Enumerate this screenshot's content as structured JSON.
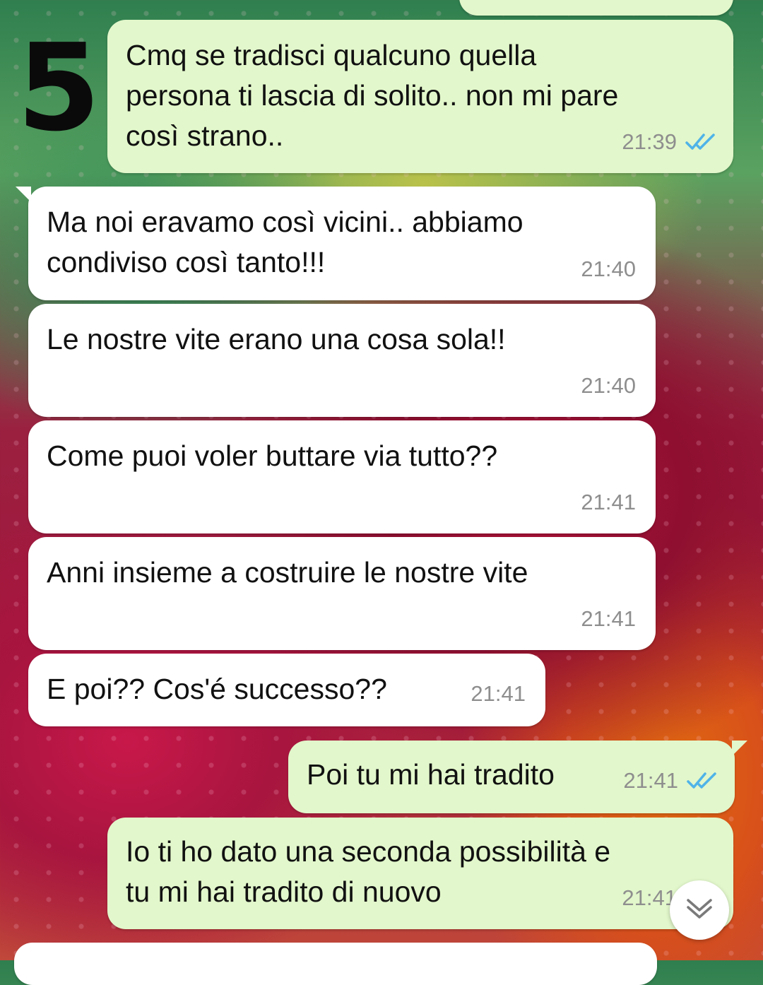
{
  "annotation": {
    "numeral": "5"
  },
  "messages": [
    {
      "direction": "out",
      "text": "Cmq se tradisci qualcuno quella\npersona ti lascia di solito.. non mi pare\ncosì strano..",
      "time": "21:39",
      "status": "read"
    },
    {
      "direction": "in",
      "text": "Ma noi eravamo così vicini.. abbiamo\ncondiviso così tanto!!!",
      "time": "21:40"
    },
    {
      "direction": "in",
      "text": "Le nostre vite erano una cosa sola!!",
      "time": "21:40"
    },
    {
      "direction": "in",
      "text": "Come puoi voler buttare via tutto??",
      "time": "21:41"
    },
    {
      "direction": "in",
      "text": "Anni insieme a costruire le nostre vite",
      "time": "21:41"
    },
    {
      "direction": "in",
      "text": "E poi?? Cos'é successo??",
      "time": "21:41"
    },
    {
      "direction": "out",
      "text": "Poi tu mi hai tradito",
      "time": "21:41",
      "status": "read"
    },
    {
      "direction": "out",
      "text": "Io ti ho dato una seconda possibilità e\ntu mi hai tradito di nuovo",
      "time": "21:41",
      "status": "read"
    }
  ],
  "colors": {
    "outgoing_bubble": "#e2f7cb",
    "incoming_bubble": "#ffffff",
    "read_ticks": "#4fb3e8",
    "timestamp": "#8e8e8e"
  },
  "icons": {
    "read_receipt": "double-check-icon",
    "scroll_down": "chevron-down-icon"
  }
}
